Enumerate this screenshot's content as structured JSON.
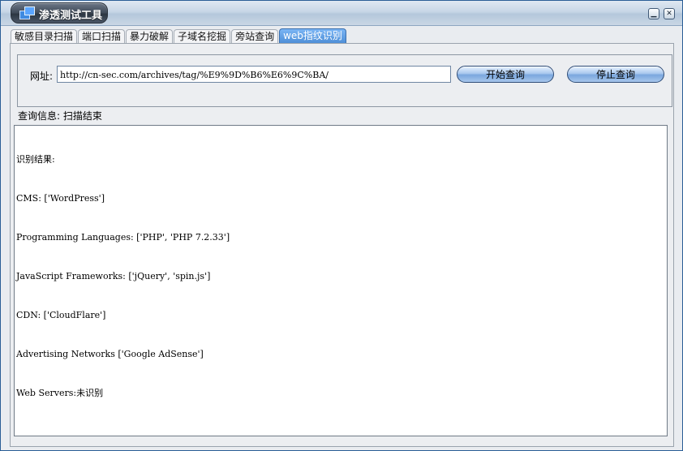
{
  "window": {
    "title": "渗透测试工具",
    "minimize_glyph": "▁",
    "close_glyph": "✕"
  },
  "tabs": [
    {
      "label": "敏感目录扫描",
      "active": false
    },
    {
      "label": "端口扫描",
      "active": false
    },
    {
      "label": "暴力破解",
      "active": false
    },
    {
      "label": "子域名挖掘",
      "active": false
    },
    {
      "label": "旁站查询",
      "active": false
    },
    {
      "label": "web指纹识别",
      "active": true
    }
  ],
  "form": {
    "url_label": "网址:",
    "url_value": "http://cn-sec.com/archives/tag/%E9%9D%B6%E6%9C%BA/",
    "start_button": "开始查询",
    "stop_button": "停止查询"
  },
  "status": {
    "text": "查询信息: 扫描结束"
  },
  "result": {
    "lines": [
      "识别结果:",
      "CMS: ['WordPress']",
      "Programming Languages: ['PHP', 'PHP 7.2.33']",
      "JavaScript Frameworks: ['jQuery', 'spin.js']",
      "CDN: ['CloudFlare']",
      "Advertising Networks ['Google AdSense']",
      "Web Servers:未识别"
    ]
  },
  "colors": {
    "active_tab": "#4e8fd8",
    "window_border": "#2a5e96",
    "button_blue": "#7aa7de"
  }
}
